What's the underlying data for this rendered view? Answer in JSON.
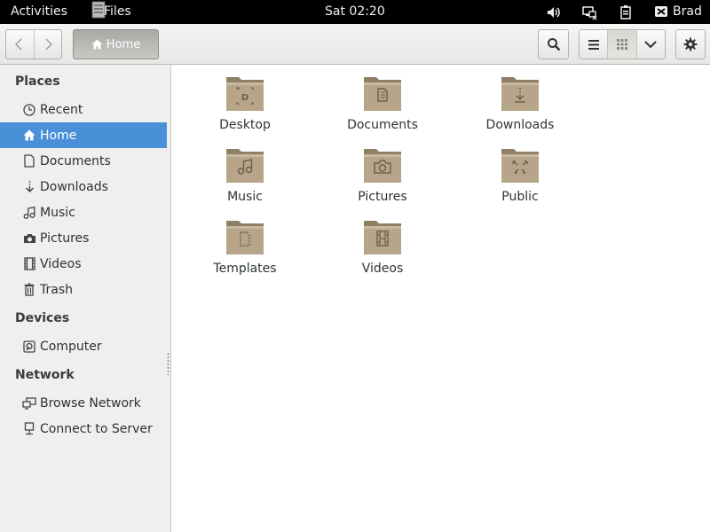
{
  "topbar": {
    "activities": "Activities",
    "app_name": "Files",
    "clock": "Sat 02:20",
    "user": "Brad"
  },
  "header": {
    "path_button": "Home"
  },
  "sidebar": {
    "places_title": "Places",
    "places": [
      {
        "label": "Recent",
        "icon": "clock-icon"
      },
      {
        "label": "Home",
        "icon": "home-icon",
        "selected": true
      },
      {
        "label": "Documents",
        "icon": "document-icon"
      },
      {
        "label": "Downloads",
        "icon": "download-icon"
      },
      {
        "label": "Music",
        "icon": "music-icon"
      },
      {
        "label": "Pictures",
        "icon": "camera-icon"
      },
      {
        "label": "Videos",
        "icon": "film-icon"
      },
      {
        "label": "Trash",
        "icon": "trash-icon"
      }
    ],
    "devices_title": "Devices",
    "devices": [
      {
        "label": "Computer",
        "icon": "drive-icon"
      }
    ],
    "network_title": "Network",
    "network": [
      {
        "label": "Browse Network",
        "icon": "network-icon"
      },
      {
        "label": "Connect to Server",
        "icon": "server-icon"
      }
    ]
  },
  "files": [
    {
      "label": "Desktop",
      "icon": "desktop-folder-icon"
    },
    {
      "label": "Documents",
      "icon": "documents-folder-icon"
    },
    {
      "label": "Downloads",
      "icon": "downloads-folder-icon"
    },
    {
      "label": "Music",
      "icon": "music-folder-icon"
    },
    {
      "label": "Pictures",
      "icon": "pictures-folder-icon"
    },
    {
      "label": "Public",
      "icon": "public-folder-icon"
    },
    {
      "label": "Templates",
      "icon": "templates-folder-icon"
    },
    {
      "label": "Videos",
      "icon": "videos-folder-icon"
    }
  ],
  "colors": {
    "selection": "#4a90d9",
    "folder": "#b7a589",
    "topbar": "#000000"
  }
}
